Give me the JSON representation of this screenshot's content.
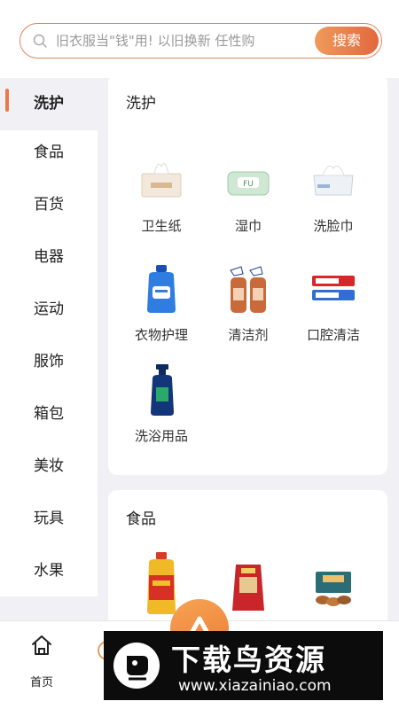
{
  "search": {
    "placeholder": "旧衣服当\"钱\"用! 以旧换新 任性购",
    "button_label": "搜索"
  },
  "sidebar": {
    "items": [
      {
        "label": "洗护",
        "active": true
      },
      {
        "label": "食品"
      },
      {
        "label": "百货"
      },
      {
        "label": "电器"
      },
      {
        "label": "运动"
      },
      {
        "label": "服饰"
      },
      {
        "label": "箱包"
      },
      {
        "label": "美妆"
      },
      {
        "label": "玩具"
      },
      {
        "label": "水果"
      }
    ]
  },
  "sections": [
    {
      "title": "洗护",
      "products": [
        {
          "name": "卫生纸",
          "icon": "tissue-box-icon"
        },
        {
          "name": "湿巾",
          "icon": "wet-wipes-icon"
        },
        {
          "name": "洗脸巾",
          "icon": "face-towel-icon"
        },
        {
          "name": "衣物护理",
          "icon": "laundry-detergent-icon"
        },
        {
          "name": "清洁剂",
          "icon": "spray-cleaner-icon"
        },
        {
          "name": "口腔清洁",
          "icon": "toothpaste-icon"
        },
        {
          "name": "洗浴用品",
          "icon": "shampoo-bottle-icon"
        }
      ]
    },
    {
      "title": "食品",
      "products": [
        {
          "name": "",
          "icon": "cooking-oil-icon"
        },
        {
          "name": "",
          "icon": "rice-bag-icon"
        },
        {
          "name": "",
          "icon": "gift-box-icon"
        }
      ]
    }
  ],
  "bottom_nav": {
    "home_label": "首页"
  },
  "watermark": {
    "title": "下载鸟资源",
    "url": "www.xiazainiao.com"
  },
  "colors": {
    "accent": "#e8794a",
    "background": "#f1f0f4"
  }
}
